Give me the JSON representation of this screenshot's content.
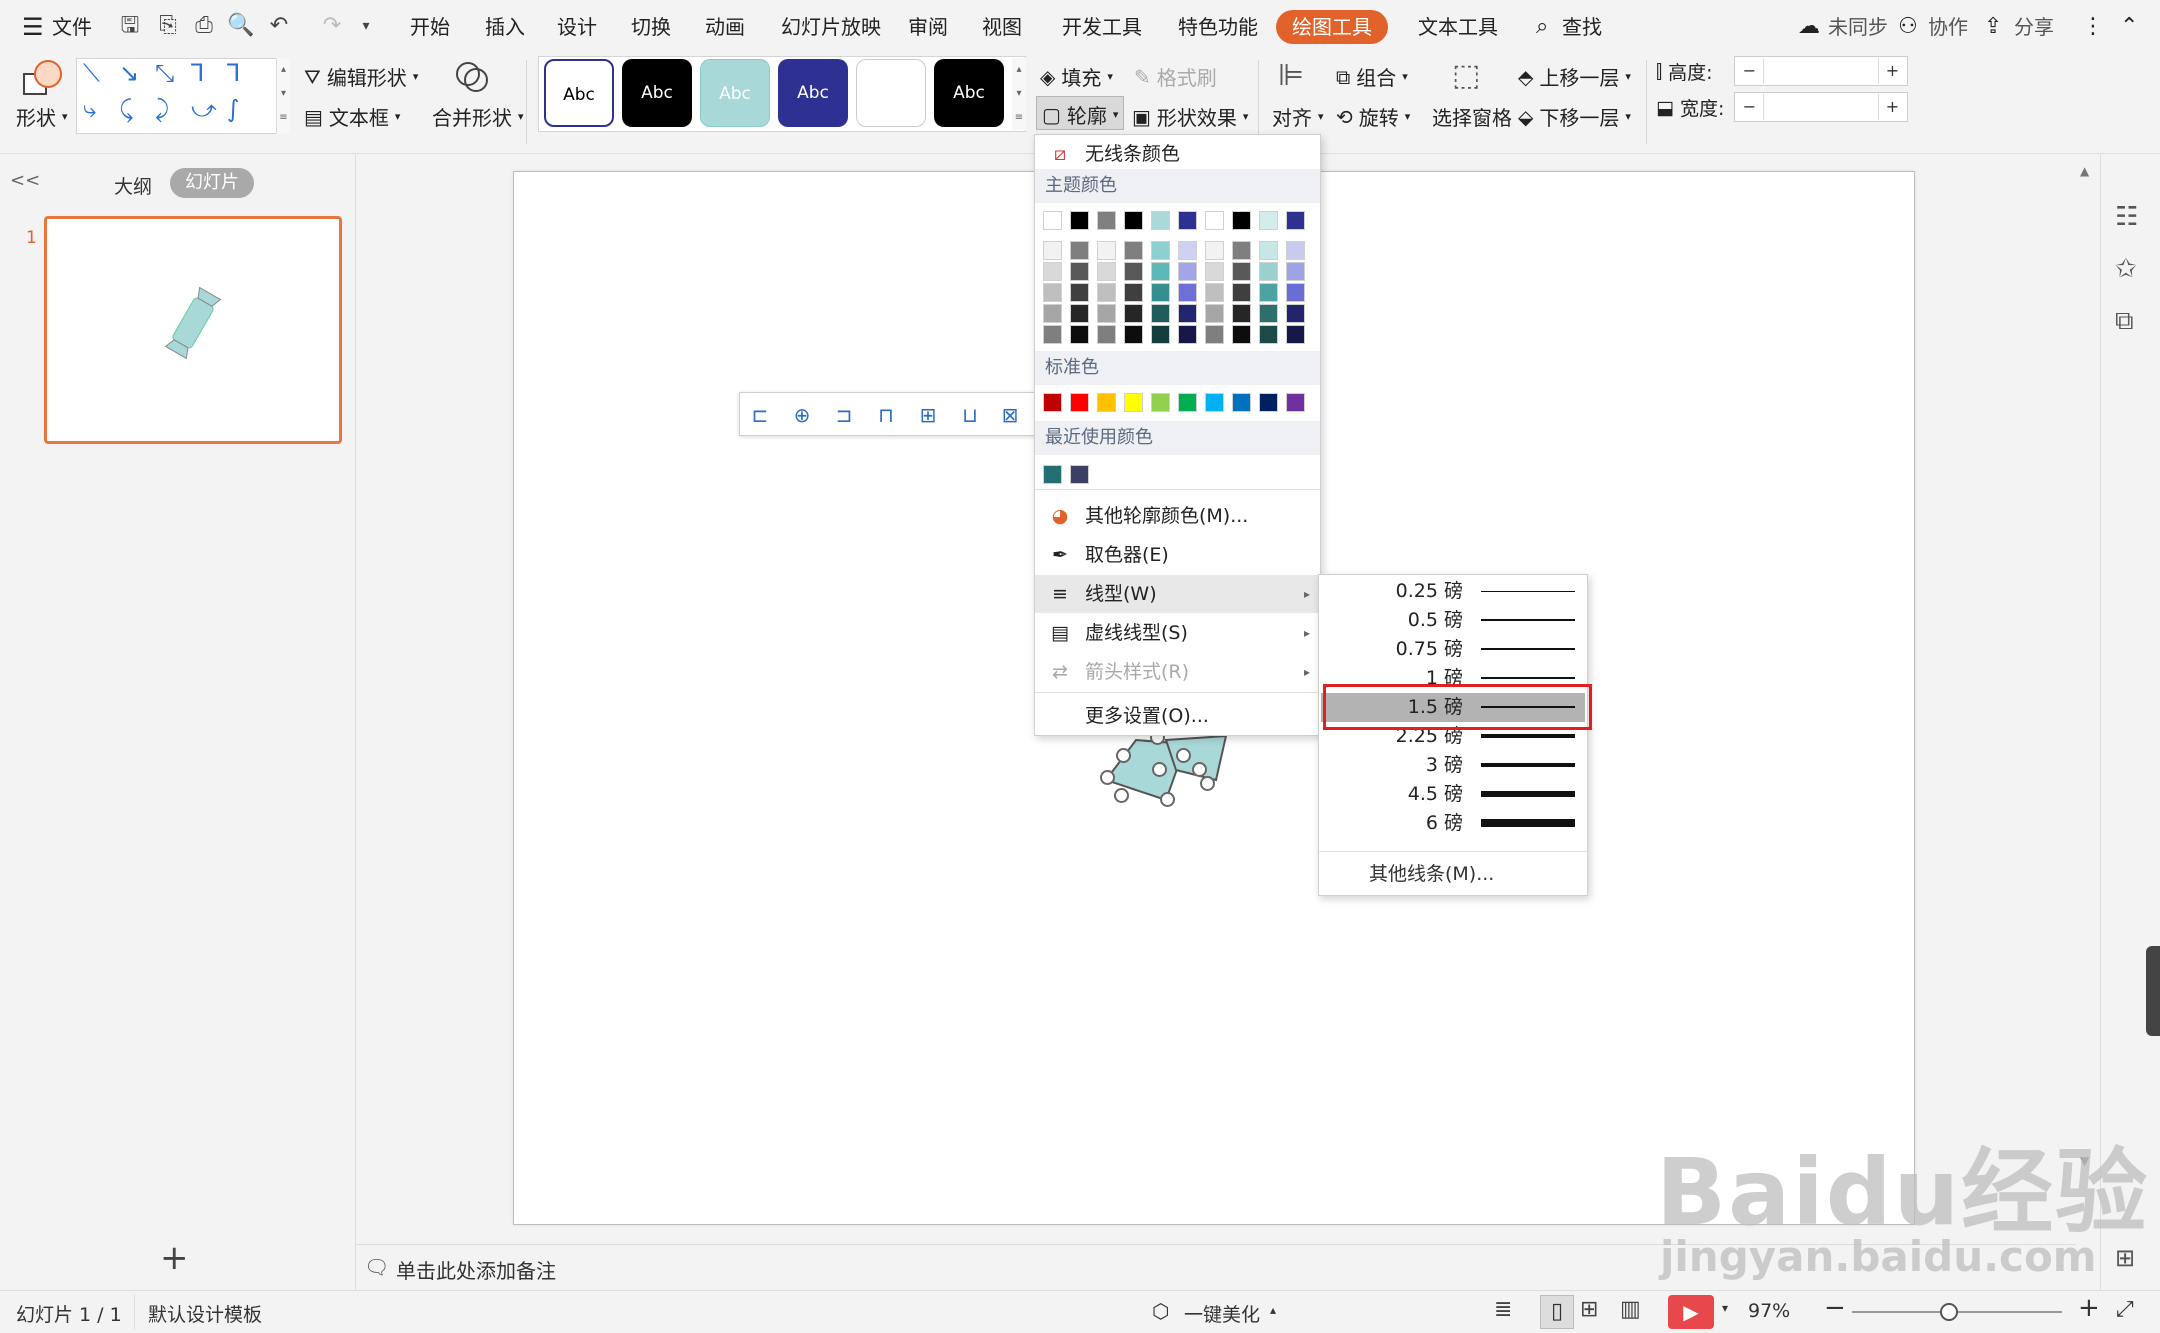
{
  "menubar": {
    "file": "文件",
    "tabs": [
      "开始",
      "插入",
      "设计",
      "切换",
      "动画",
      "幻灯片放映",
      "审阅",
      "视图",
      "开发工具",
      "特色功能",
      "绘图工具",
      "文本工具"
    ],
    "active_tab": "绘图工具",
    "search": "查找",
    "sync": "未同步",
    "collab": "协作",
    "share": "分享"
  },
  "ribbon": {
    "shape": "形状",
    "edit_shape": "编辑形状",
    "textbox": "文本框",
    "merge_shape": "合并形状",
    "style_label": "Abc",
    "fill": "填充",
    "format_brush": "格式刷",
    "outline": "轮廓",
    "shape_effect": "形状效果",
    "align": "对齐",
    "group": "组合",
    "rotate": "旋转",
    "select_pane": "选择窗格",
    "bring_forward": "上移一层",
    "send_backward": "下移一层",
    "height": "高度:",
    "width": "宽度:",
    "minus": "−",
    "plus": "+"
  },
  "left_panel": {
    "outline_tab": "大纲",
    "slides_tab": "幻灯片",
    "slide_number": "1",
    "collapse": "<<",
    "add": "+"
  },
  "outline_menu": {
    "no_line": "无线条颜色",
    "theme_colors": "主题颜色",
    "theme_top": [
      "#ffffff",
      "#000000",
      "#808080",
      "#000000",
      "#abd9d9",
      "#2e3192",
      "#ffffff",
      "#000000",
      "#d4ecec",
      "#2e3192"
    ],
    "theme_shades": [
      [
        "#f2f2f2",
        "#7f7f7f",
        "#f2f2f2",
        "#7f7f7f",
        "#8ecfcf",
        "#d0d1f2",
        "#f2f2f2",
        "#7f7f7f",
        "#c7e6e6",
        "#c9caf0"
      ],
      [
        "#d9d9d9",
        "#595959",
        "#d9d9d9",
        "#595959",
        "#5fb8b8",
        "#a3a5e8",
        "#d9d9d9",
        "#595959",
        "#99d1d1",
        "#a0a2e6"
      ],
      [
        "#bfbfbf",
        "#3f3f3f",
        "#bfbfbf",
        "#3f3f3f",
        "#358f8f",
        "#6d70d6",
        "#bfbfbf",
        "#3f3f3f",
        "#4da3a3",
        "#6a6dd4"
      ],
      [
        "#a6a6a6",
        "#262626",
        "#a6a6a6",
        "#262626",
        "#1f5c5c",
        "#23256e",
        "#a6a6a6",
        "#262626",
        "#2e6e6e",
        "#22246c"
      ],
      [
        "#7f7f7f",
        "#0d0d0d",
        "#7f7f7f",
        "#0d0d0d",
        "#143d3d",
        "#171849",
        "#7f7f7f",
        "#0d0d0d",
        "#1e4949",
        "#161848"
      ]
    ],
    "standard_colors": "标准色",
    "standard": [
      "#c00000",
      "#ff0000",
      "#ffc000",
      "#ffff00",
      "#92d050",
      "#00b050",
      "#00b0f0",
      "#0070c0",
      "#002060",
      "#7030a0"
    ],
    "recent_colors": "最近使用颜色",
    "recent": [
      "#236f74",
      "#3b3f63"
    ],
    "more_colors": "其他轮廓颜色(M)...",
    "eyedropper": "取色器(E)",
    "line_style": "线型(W)",
    "dash_style": "虚线线型(S)",
    "arrow_style": "箭头样式(R)",
    "more_settings": "更多设置(O)..."
  },
  "line_weights": {
    "items": [
      "0.25 磅",
      "0.5 磅",
      "0.75 磅",
      "1 磅",
      "1.5 磅",
      "2.25 磅",
      "3 磅",
      "4.5 磅",
      "6 磅"
    ],
    "selected": "1.5 磅",
    "other": "其他线条(M)..."
  },
  "notes": "单击此处添加备注",
  "statusbar": {
    "slide_info": "幻灯片 1 / 1",
    "template": "默认设计模板",
    "beautify": "一键美化",
    "zoom": "97%"
  },
  "watermark": {
    "brand": "Baidu经验",
    "url": "jingyan.baidu.com"
  },
  "colors": {
    "accent": "#e2622c",
    "selection": "#e02020",
    "candy": "#a9d8d8"
  }
}
